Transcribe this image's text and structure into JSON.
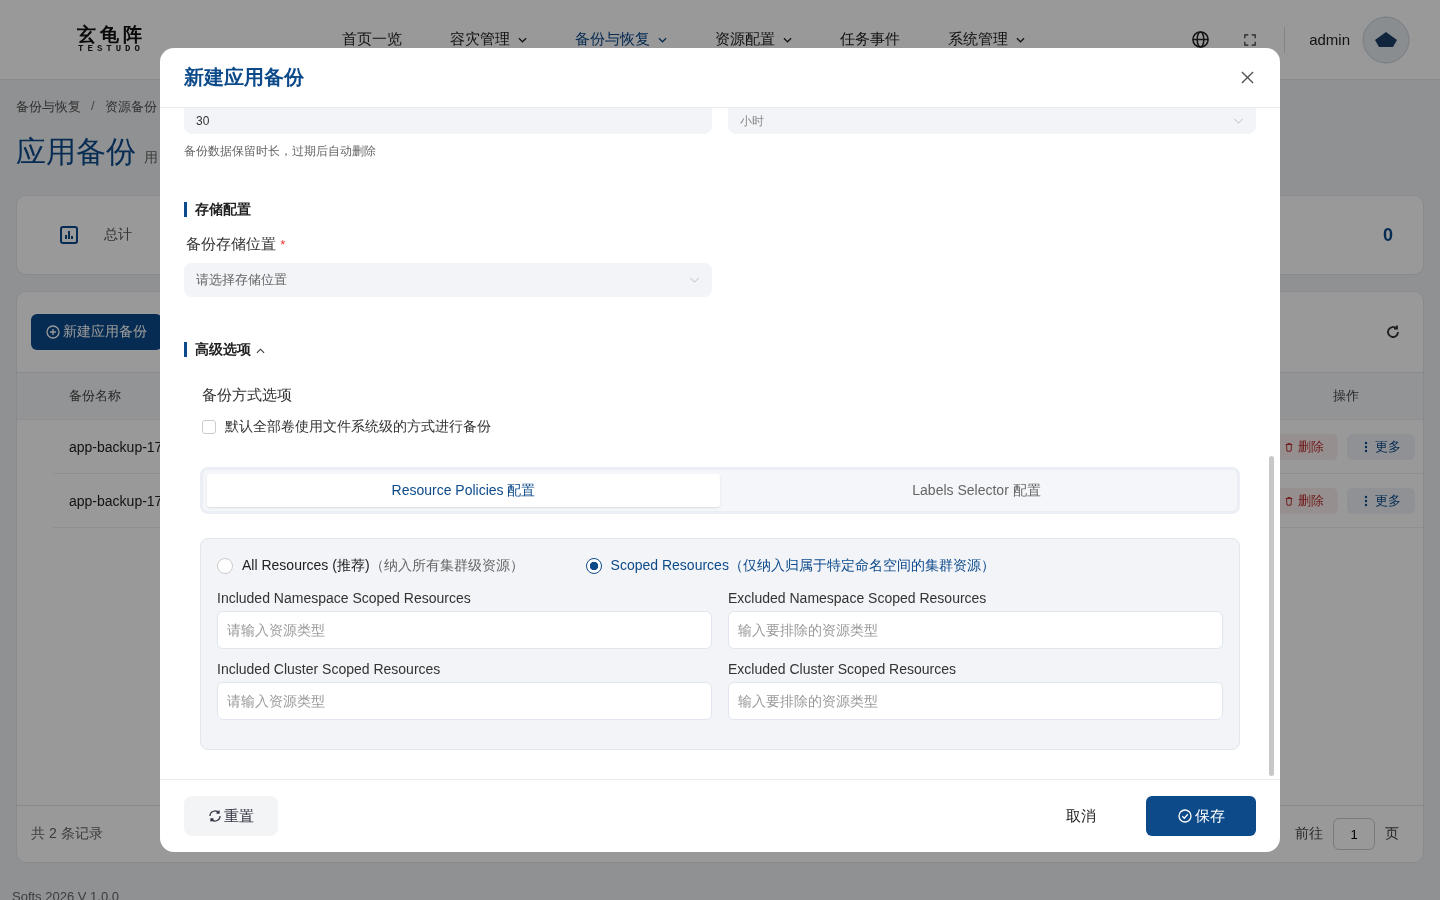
{
  "header": {
    "logo": {
      "name": "玄龟阵",
      "latin": "TESTUDO"
    },
    "nav": [
      {
        "label": "首页一览",
        "dropdown": false,
        "selected": false
      },
      {
        "label": "容灾管理",
        "dropdown": true,
        "selected": false
      },
      {
        "label": "备份与恢复",
        "dropdown": true,
        "selected": true
      },
      {
        "label": "资源配置",
        "dropdown": true,
        "selected": false
      },
      {
        "label": "任务事件",
        "dropdown": false,
        "selected": false
      },
      {
        "label": "系统管理",
        "dropdown": true,
        "selected": false
      }
    ],
    "user": "admin"
  },
  "breadcrumb": {
    "items": [
      "备份与恢复",
      "资源备份"
    ],
    "separator": "/"
  },
  "page": {
    "title": "应用备份",
    "subtitle": "用"
  },
  "stats": {
    "label": "总计",
    "value": "0"
  },
  "toolbar": {
    "new_button": "新建应用备份"
  },
  "table": {
    "columns": [
      "备份名称",
      "操作"
    ],
    "rows": [
      {
        "name": "app-backup-17",
        "actions": [
          "删除",
          "更多"
        ]
      },
      {
        "name": "app-backup-17",
        "actions": [
          "删除",
          "更多"
        ]
      }
    ]
  },
  "pagination": {
    "total": "共 2 条记录",
    "goto": "前往",
    "page": "1",
    "suffix": "页"
  },
  "footer": "Softs 2026 V 1.0.0",
  "dialog": {
    "title": "新建应用备份",
    "retention": {
      "value": "30",
      "unit": "小时",
      "hint": "备份数据保留时长，过期后自动删除"
    },
    "storage": {
      "heading": "存储配置",
      "label": "备份存储位置",
      "required_mark": "*",
      "placeholder": "请选择存储位置"
    },
    "advanced": {
      "heading": "高级选项",
      "expanded": true,
      "option_label": "备份方式选项",
      "checkbox": {
        "label": "默认全部卷使用文件系统级的方式进行备份",
        "checked": false
      },
      "tabs": [
        {
          "label": "Resource Policies 配置",
          "selected": true
        },
        {
          "label": "Labels Selector 配置",
          "selected": false
        }
      ],
      "scope_options": [
        {
          "label": "All Resources (推荐)",
          "note": "（纳入所有集群级资源）",
          "selected": false
        },
        {
          "label": "Scoped Resources",
          "note": "（仅纳入归属于特定命名空间的集群资源）",
          "selected": true
        }
      ],
      "fields": [
        {
          "label": "Included Namespace Scoped Resources",
          "placeholder": "请输入资源类型"
        },
        {
          "label": "Excluded Namespace Scoped Resources",
          "placeholder": "输入要排除的资源类型"
        },
        {
          "label": "Included Cluster Scoped Resources",
          "placeholder": "请输入资源类型"
        },
        {
          "label": "Excluded Cluster Scoped Resources",
          "placeholder": "输入要排除的资源类型"
        }
      ]
    },
    "buttons": {
      "reset": "重置",
      "cancel": "取消",
      "save": "保存"
    }
  }
}
